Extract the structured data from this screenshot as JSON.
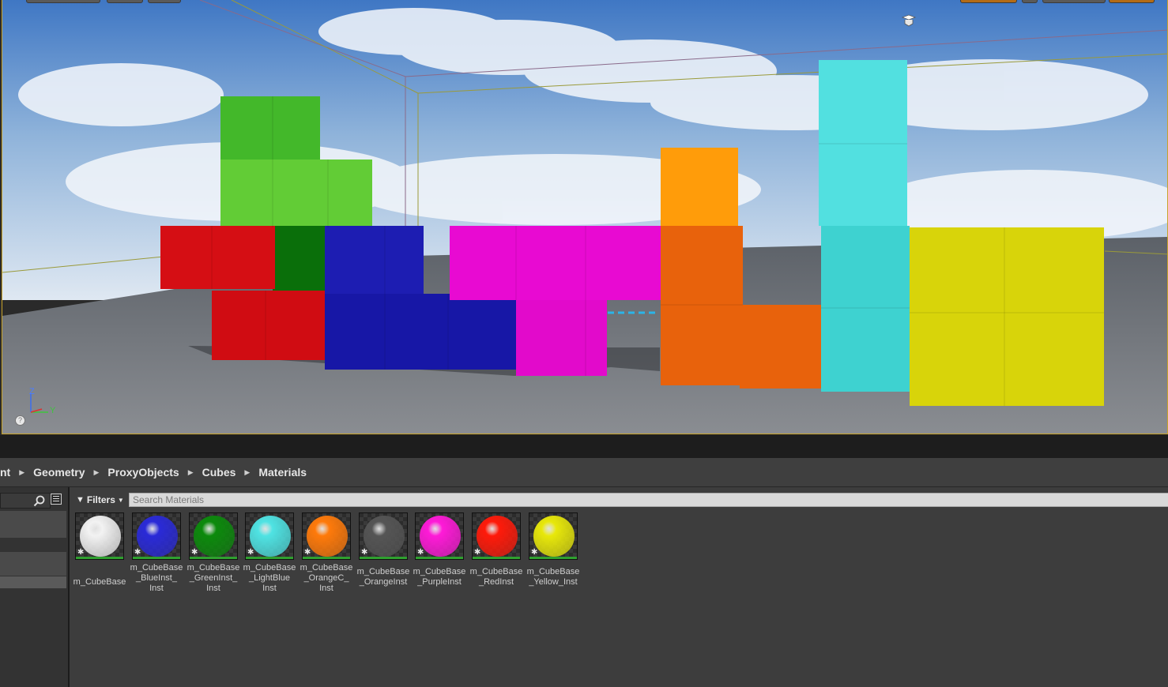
{
  "breadcrumb": [
    "nt",
    "Geometry",
    "ProxyObjects",
    "Cubes",
    "Materials"
  ],
  "toolbar": {
    "filters_label": "Filters",
    "search_placeholder": "Search Materials"
  },
  "viewport": {
    "axis": {
      "z": "Z",
      "y": "Y"
    },
    "help": "?"
  },
  "assets": [
    {
      "name": "m_CubeBase",
      "color": "#f2f2f2"
    },
    {
      "name": "m_CubeBase\n_BlueInst_\nInst",
      "color": "#2a2ad8"
    },
    {
      "name": "m_CubeBase\n_GreenInst_\nInst",
      "color": "#0c8a0c"
    },
    {
      "name": "m_CubeBase\n_LightBlue\nInst",
      "color": "#4fe3e3"
    },
    {
      "name": "m_CubeBase\n_OrangeC_\nInst",
      "color": "#ff7a0a"
    },
    {
      "name": "m_CubeBase\n_OrangeInst",
      "color": "#555555"
    },
    {
      "name": "m_CubeBase\n_PurpleInst",
      "color": "#ff1ad8"
    },
    {
      "name": "m_CubeBase\n_RedInst",
      "color": "#ff1a0a"
    },
    {
      "name": "m_CubeBase\n_Yellow_Inst",
      "color": "#e8e80a"
    }
  ]
}
